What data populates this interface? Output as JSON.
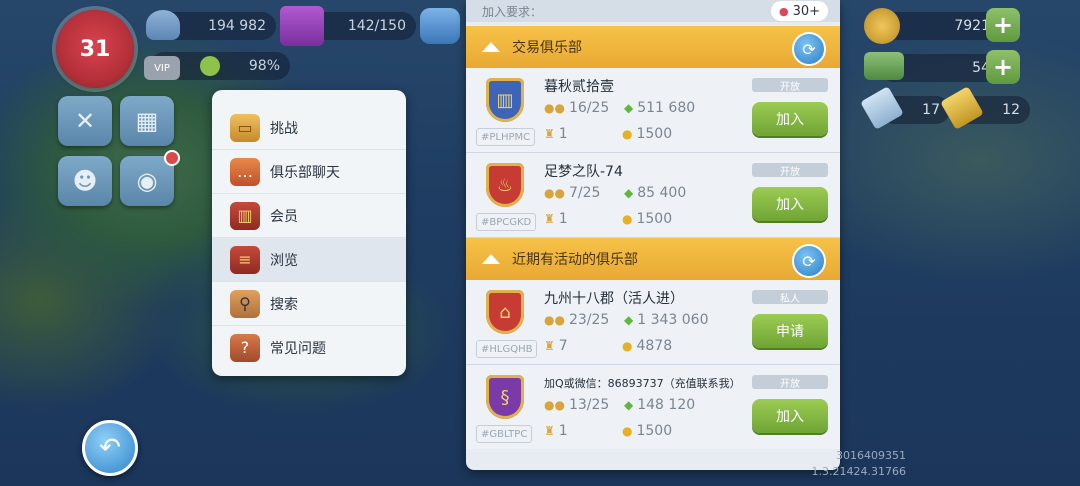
{
  "hud": {
    "level": "31",
    "population": "194 982",
    "storage": "142/150",
    "happiness": "98%",
    "simoleons": "7921",
    "simcash": "54",
    "keys_platinum": "17",
    "keys_golden": "12",
    "vip_label": "VIP"
  },
  "menu": {
    "items": [
      {
        "label": "挑战",
        "icon": "chest-icon"
      },
      {
        "label": "俱乐部聊天",
        "icon": "chat-icon"
      },
      {
        "label": "会员",
        "icon": "club-shield-icon"
      },
      {
        "label": "浏览",
        "icon": "browse-shield-icon"
      },
      {
        "label": "搜索",
        "icon": "magnifier-icon"
      },
      {
        "label": "常见问题",
        "icon": "book-icon"
      }
    ]
  },
  "panel": {
    "requirement_label": "加入要求：",
    "requirement_value": "30+",
    "section1_title": "交易俱乐部",
    "section2_title": "近期有活动的俱乐部",
    "clubs": [
      {
        "name": "暮秋贰拾壹",
        "tag": "#PLHPMC",
        "members": "16/25",
        "points": "511 680",
        "level": "1",
        "requirement": "1500",
        "status": "开放",
        "action": "加入",
        "color": "#3e64b8",
        "emblem": "▥"
      },
      {
        "name": "足梦之队-74",
        "tag": "#BPCGKD",
        "members": "7/25",
        "points": "85 400",
        "level": "1",
        "requirement": "1500",
        "status": "开放",
        "action": "加入",
        "color": "#c63b34",
        "emblem": "♨"
      },
      {
        "name": "九州十八郡（活人进）",
        "tag": "#HLGQHB",
        "members": "23/25",
        "points": "1 343 060",
        "level": "7",
        "requirement": "4878",
        "status": "私人",
        "action": "申请",
        "color": "#c63b34",
        "emblem": "⌂"
      },
      {
        "name": "加Q或微信：86893737（充值联系我）",
        "tag": "#GBLTPC",
        "members": "13/25",
        "points": "148 120",
        "level": "1",
        "requirement": "1500",
        "status": "开放",
        "action": "加入",
        "color": "#7a3aa8",
        "emblem": "§"
      }
    ]
  },
  "footer": {
    "version_line1": "3016409351",
    "version_line2": "1.3.21424.31766"
  }
}
